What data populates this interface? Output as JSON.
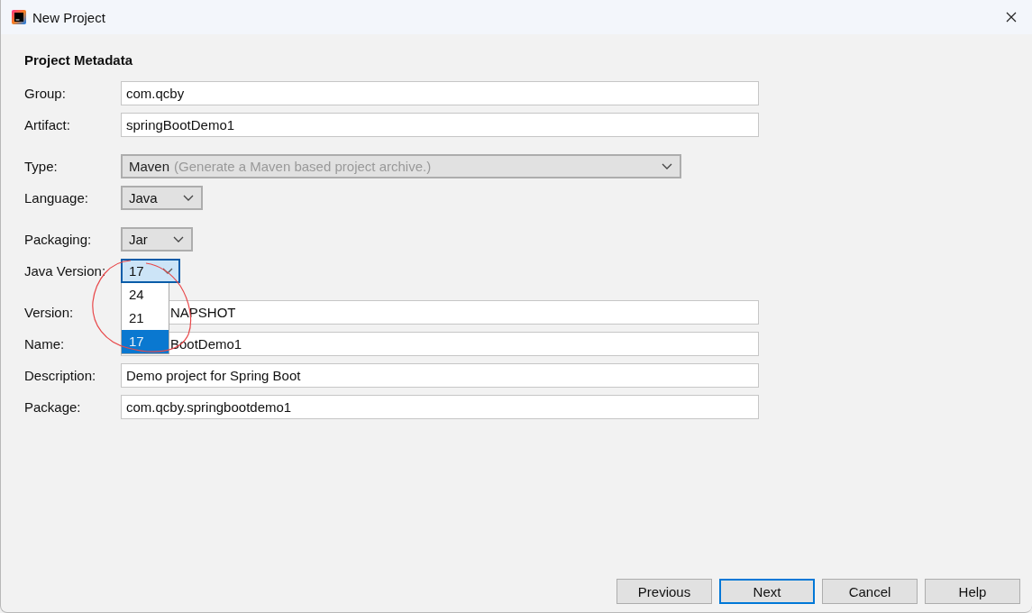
{
  "window": {
    "title": "New Project"
  },
  "heading": "Project Metadata",
  "sections": [
    [
      {
        "kind": "text",
        "label": "Group:",
        "value": "com.qcby",
        "covered": false
      },
      {
        "kind": "text",
        "label": "Artifact:",
        "value": "springBootDemo1",
        "covered": false
      }
    ],
    [
      {
        "kind": "combo",
        "label": "Type:",
        "value": "Maven",
        "hint": "(Generate a Maven based project archive.)",
        "disabled": true,
        "open": false
      },
      {
        "kind": "combo",
        "label": "Language:",
        "value": "Java",
        "disabled": false,
        "open": false
      }
    ],
    [
      {
        "kind": "combo",
        "label": "Packaging:",
        "value": "Jar",
        "disabled": false,
        "open": false
      },
      {
        "kind": "combo",
        "label": "Java Version:",
        "value": "17",
        "disabled": false,
        "open": true,
        "options": [
          {
            "label": "24",
            "selected": false
          },
          {
            "label": "21",
            "selected": false
          },
          {
            "label": "17",
            "selected": true
          }
        ]
      }
    ],
    [
      {
        "kind": "text",
        "label": "Version:",
        "value": "NAPSHOT",
        "covered": true
      },
      {
        "kind": "text",
        "label": "Name:",
        "value": "BootDemo1",
        "covered": true
      },
      {
        "kind": "text",
        "label": "Description:",
        "value": "Demo project for Spring Boot",
        "covered": false
      },
      {
        "kind": "text",
        "label": "Package:",
        "value": "com.qcby.springbootdemo1",
        "covered": false
      }
    ]
  ],
  "buttons": [
    {
      "label": "Previous",
      "default": false
    },
    {
      "label": "Next",
      "default": true
    },
    {
      "label": "Cancel",
      "default": false
    },
    {
      "label": "Help",
      "default": false
    }
  ]
}
